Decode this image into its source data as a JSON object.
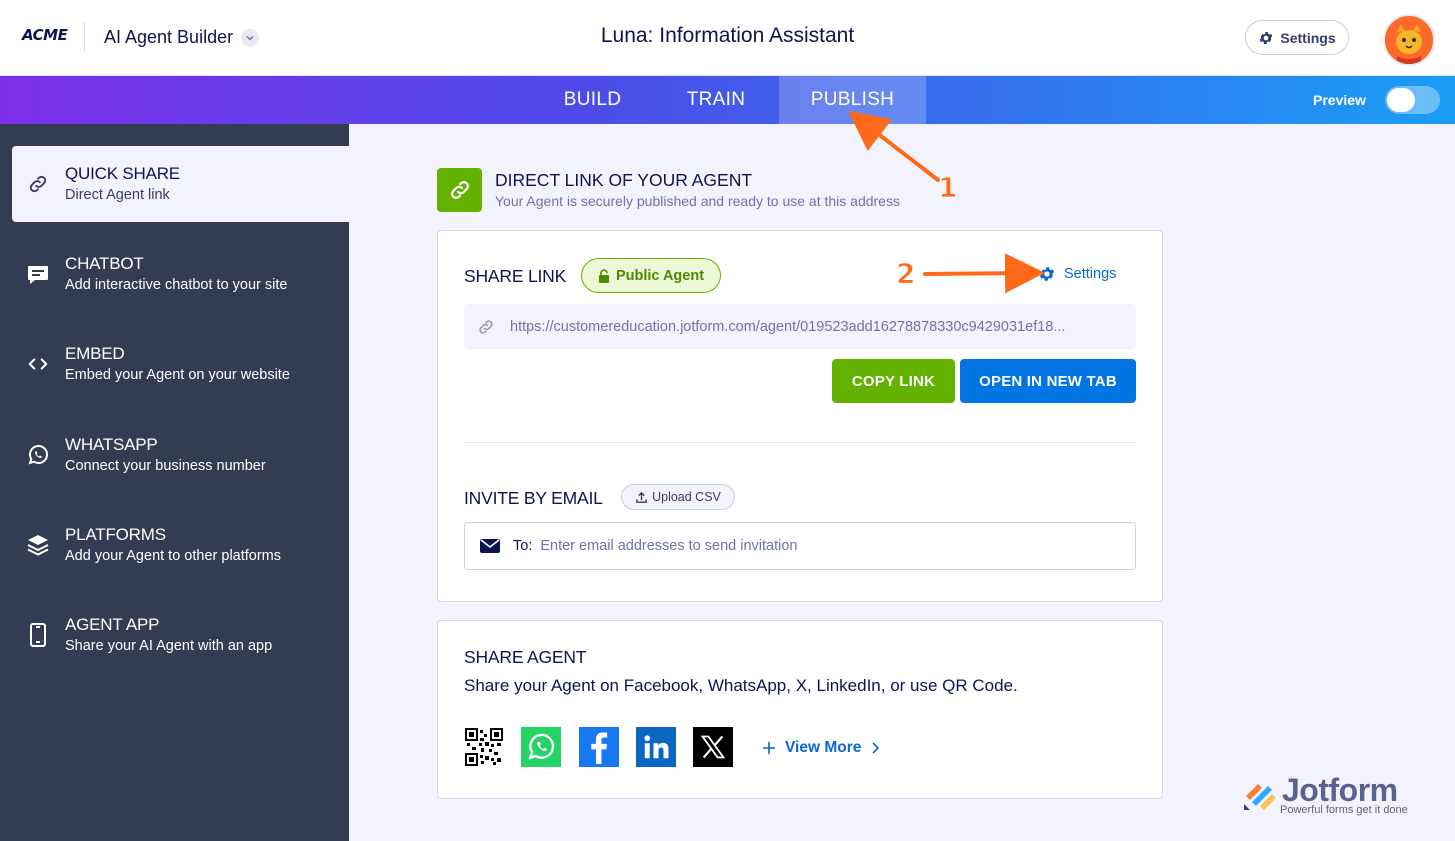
{
  "header": {
    "logo": "ACME",
    "product": "AI Agent Builder",
    "title": "Luna: Information Assistant",
    "settings_label": "Settings"
  },
  "nav": {
    "tabs": [
      {
        "label": "BUILD"
      },
      {
        "label": "TRAIN"
      },
      {
        "label": "PUBLISH",
        "active": true
      }
    ],
    "preview_label": "Preview"
  },
  "sidebar": {
    "items": [
      {
        "title": "QUICK SHARE",
        "subtitle": "Direct Agent link",
        "icon": "link-icon",
        "active": true
      },
      {
        "title": "CHATBOT",
        "subtitle": "Add interactive chatbot to your site",
        "icon": "chat-icon"
      },
      {
        "title": "EMBED",
        "subtitle": "Embed your Agent on your website",
        "icon": "code-icon"
      },
      {
        "title": "WHATSAPP",
        "subtitle": "Connect your business number",
        "icon": "whatsapp-icon"
      },
      {
        "title": "PLATFORMS",
        "subtitle": "Add your Agent to other platforms",
        "icon": "layers-icon"
      },
      {
        "title": "AGENT APP",
        "subtitle": "Share your AI Agent with an app",
        "icon": "phone-icon"
      }
    ]
  },
  "direct": {
    "title": "DIRECT LINK OF YOUR AGENT",
    "subtitle": "Your Agent is securely published and ready to use at this address"
  },
  "share_link": {
    "title": "SHARE LINK",
    "badge": "Public Agent",
    "settings": "Settings",
    "url": "https://customereducation.jotform.com/agent/019523add16278878330c9429031ef18...",
    "copy_label": "COPY LINK",
    "open_label": "OPEN IN NEW TAB"
  },
  "invite": {
    "title": "INVITE BY EMAIL",
    "upload_label": "Upload CSV",
    "to_label": "To:",
    "placeholder": "Enter email addresses to send invitation"
  },
  "share_agent": {
    "title": "SHARE AGENT",
    "subtitle": "Share your Agent on Facebook, WhatsApp, X, LinkedIn, or use QR Code.",
    "icons": [
      "qr-code-icon",
      "whatsapp-icon",
      "facebook-icon",
      "linkedin-icon",
      "x-icon"
    ],
    "view_more": "View More"
  },
  "annotations": [
    "1",
    "2"
  ],
  "watermark": {
    "brand": "Jotform",
    "tagline": "Powerful forms get it done"
  },
  "colors": {
    "accent_green": "#64b200",
    "accent_blue": "#0075e3",
    "sidebar_bg": "#343c54",
    "annotation": "#ff6a1a"
  }
}
